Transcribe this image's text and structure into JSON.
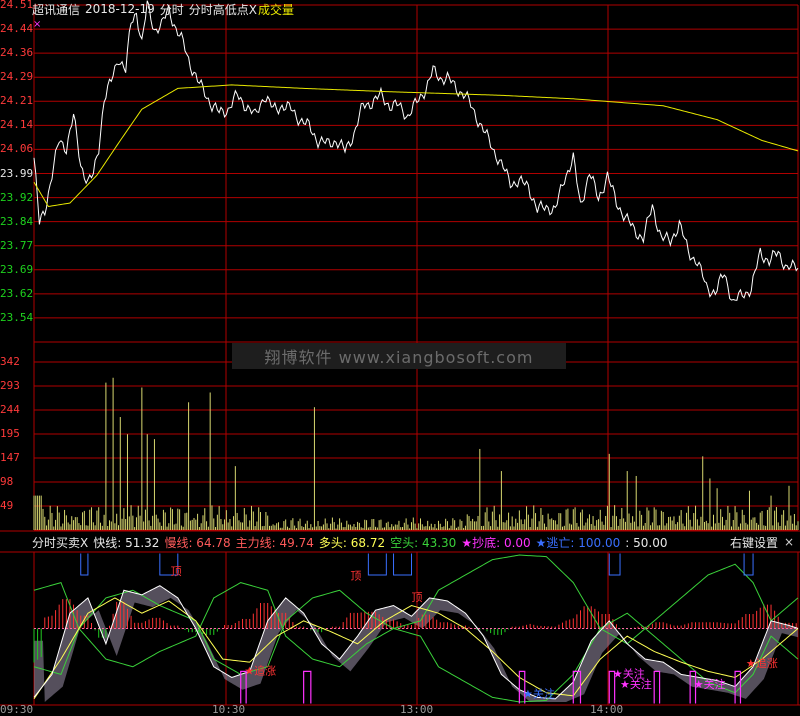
{
  "header": {
    "stock_name": "超讯通信",
    "date": "2018-12-19",
    "mode": "分时",
    "indicator_label": "分时高低点X",
    "volume_label": "成交量",
    "marker": "×"
  },
  "colors": {
    "price_line": "#ffffff",
    "avg_line": "#e8e800",
    "grid": "#b00000",
    "up_label": "#ff3a3a",
    "down_label": "#1ed31e",
    "volume": "#d8d870",
    "fast": "#ffffff",
    "slow": "#ff5a5a",
    "main": "#ffff55",
    "bull": "#3ad13a",
    "bear": "#3a6fff",
    "buy_mark": "#ff33ff",
    "sell_mark": "#3a6fff"
  },
  "price_axis": {
    "up_labels": [
      "24.51",
      "24.44",
      "24.36",
      "24.29",
      "24.21",
      "24.14",
      "24.06"
    ],
    "mid_label": "23.99",
    "down_labels": [
      "23.92",
      "23.84",
      "23.77",
      "23.69",
      "23.62",
      "23.54"
    ],
    "ylim": [
      23.54,
      24.51
    ]
  },
  "volume_axis": {
    "labels": [
      "342",
      "293",
      "244",
      "195",
      "147",
      "98",
      "49"
    ],
    "ymax": 342
  },
  "watermark": "翔博软件 www.xiangbosoft.com",
  "subpanel": {
    "title": "分时买卖X",
    "fields": [
      {
        "name": "快线",
        "value": "51.32"
      },
      {
        "name": "慢线",
        "value": "64.78"
      },
      {
        "name": "主力线",
        "value": "49.74"
      },
      {
        "name": "多头",
        "value": "68.72"
      },
      {
        "name": "空头",
        "value": "43.30"
      },
      {
        "name": "★抄底",
        "value": "0.00"
      },
      {
        "name": "★逃亡",
        "value": "100.00"
      },
      {
        "name": "",
        "value": "50.00"
      }
    ],
    "settings": "右键设置",
    "close": "×",
    "signals": {
      "top1": "顶",
      "top2": "顶",
      "top3": "顶",
      "chase1": "★追涨",
      "chase2": "★追涨",
      "watch1": "★关注",
      "watch2": "★关注",
      "watch3": "★关注",
      "watch4": "★关注"
    }
  },
  "time_axis": {
    "labels": [
      "09:30",
      "10:30",
      "13:00",
      "14:00"
    ]
  }
}
